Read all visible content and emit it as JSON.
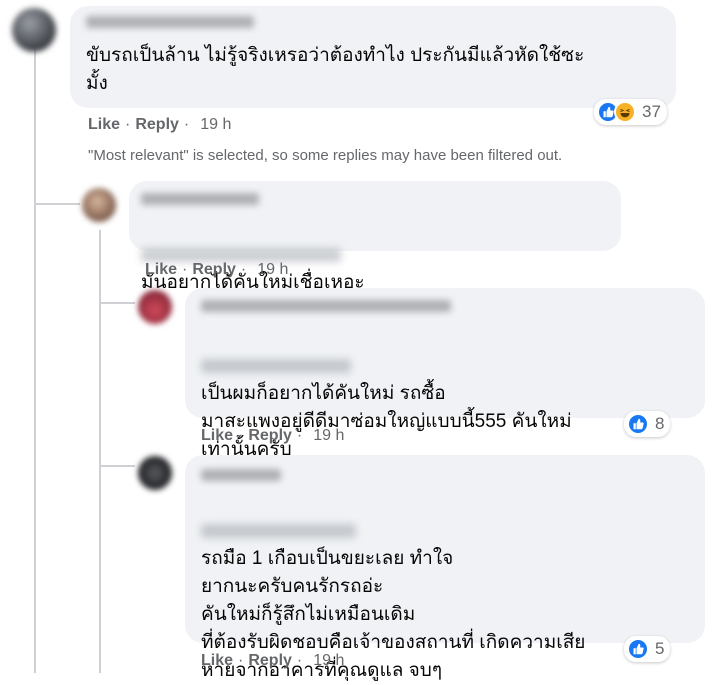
{
  "comments": [
    {
      "id": "c1",
      "text": "ขับรถเป็นล้าน ไม่รู้จริงเหรอว่าต้องทำไง ประกันมีแล้วหัดใช้ซะ\nมั้ง",
      "actions": {
        "like": "Like",
        "reply": "Reply",
        "time": "19 h"
      },
      "reactions": {
        "icons": [
          "like-icon",
          "haha-icon"
        ],
        "count": "37"
      }
    },
    {
      "id": "c2",
      "text": "มันอยากได้คันใหม่เชื่อเหอะ",
      "actions": {
        "like": "Like",
        "reply": "Reply",
        "time": "19 h"
      }
    },
    {
      "id": "c3",
      "text": "เป็นผมก็อยากได้คันใหม่ รถซื้อ\nมาสะแพงอยู่ดีดีมาซ่อมใหญ่แบบนี้555 คันใหม่\nเท่านั้นครับ",
      "actions": {
        "like": "Like",
        "reply": "Reply",
        "time": "19 h"
      },
      "reactions": {
        "icons": [
          "like-icon"
        ],
        "count": "8"
      }
    },
    {
      "id": "c4",
      "text": "รถมือ 1 เกือบเป็นขยะเลย ทำใจ\nยากนะครับคนรักรถอ่ะ\nคันใหม่ก็รู้สึกไม่เหมือนเดิม\nที่ต้องรับผิดชอบคือเจ้าของสถานที่ เกิดความเสีย\nหายจากอาคารที่คุณดูแล จบๆ",
      "actions": {
        "like": "Like",
        "reply": "Reply",
        "time": "19 h"
      },
      "reactions": {
        "icons": [
          "like-icon"
        ],
        "count": "5"
      }
    }
  ],
  "filter_notice": "\"Most relevant\" is selected, so some replies may have been filtered out.",
  "colors": {
    "like_blue": "#1877f2",
    "haha_yellow": "#f7b125",
    "bubble": "#f0f2f5",
    "meta_gray": "#65676b"
  }
}
